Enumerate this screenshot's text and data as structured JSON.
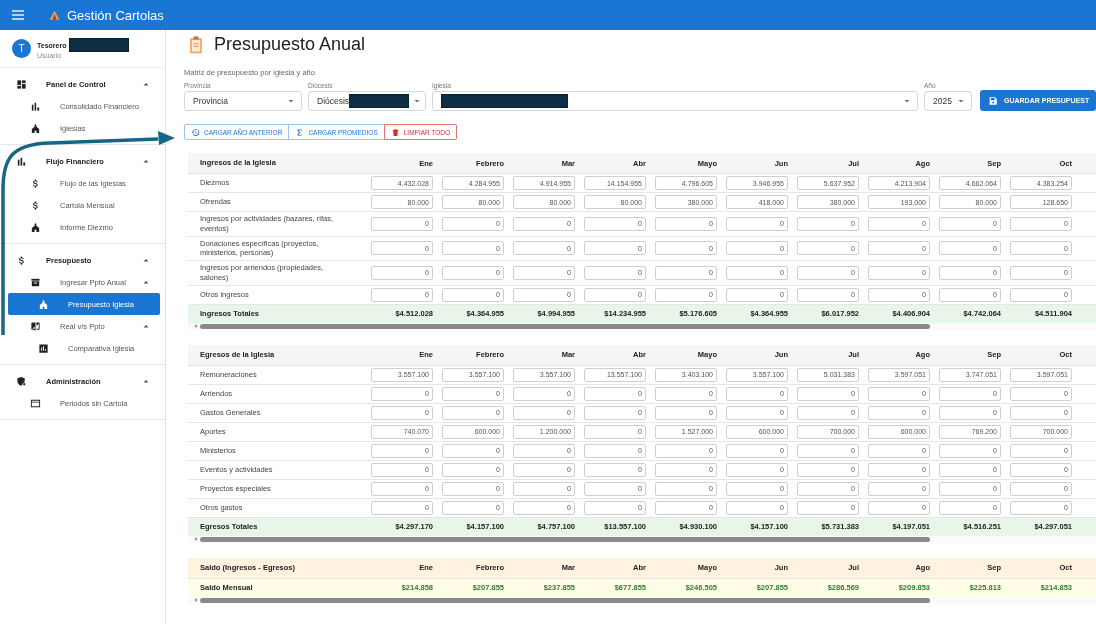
{
  "app_bar": {
    "title": "Gestión Cartolas"
  },
  "user": {
    "avatar": "T",
    "name": "Tesorero",
    "role": "Usuario",
    "redacted": true
  },
  "sidebar": {
    "sections": [
      {
        "label": "Panel de Control",
        "expanded": true,
        "items": [
          {
            "label": "Consolidado Financiero",
            "selected": false
          },
          {
            "label": "Iglesias",
            "selected": false
          }
        ]
      },
      {
        "label": "Flujo Financiero",
        "expanded": true,
        "items": [
          {
            "label": "Flujo de las Iglesias",
            "selected": false
          },
          {
            "label": "Cartola Mensual",
            "selected": false
          },
          {
            "label": "Informe Diezmo",
            "selected": false
          }
        ]
      },
      {
        "label": "Presupuesto",
        "expanded": true,
        "items": [
          {
            "label": "Ingresar Ppto Anual",
            "selected": false,
            "expanded": true,
            "children": [
              {
                "label": "Presupuesto Iglesia",
                "selected": true
              }
            ]
          },
          {
            "label": "Real v/s Ppto",
            "selected": false,
            "expanded": true,
            "children": [
              {
                "label": "Comparativa Iglesia",
                "selected": false
              }
            ]
          }
        ]
      },
      {
        "label": "Administración",
        "expanded": true,
        "items": [
          {
            "label": "Periodos sin Cartola",
            "selected": false
          }
        ]
      }
    ]
  },
  "page": {
    "title": "Presupuesto Anual",
    "subtitle": "Matriz de presupuesto por iglesia y año"
  },
  "filters": [
    {
      "label": "Provincia",
      "value": "Provincia"
    },
    {
      "label": "Diócesis",
      "value": "Diócesis",
      "redacted": true
    },
    {
      "label": "Iglesia",
      "redacted": true
    },
    {
      "label": "Año",
      "value": "2025"
    }
  ],
  "save_button": "GUARDAR PRESUPUEST",
  "actions": [
    {
      "label": "CARGAR AÑO ANTERIOR",
      "kind": "history"
    },
    {
      "label": "CARGAR PROMEDIOS",
      "kind": "sigma"
    },
    {
      "label": "LIMPIAR TODO",
      "kind": "danger"
    }
  ],
  "tables": [
    {
      "kind": "income",
      "title": "Ingresos de la Iglesia",
      "columns": [
        "Ene",
        "Febrero",
        "Mar",
        "Abr",
        "Mayo",
        "Jun",
        "Jul",
        "Ago",
        "Sep",
        "Oct"
      ],
      "rows": [
        {
          "label": "Diezmos",
          "values": [
            "4.432.028",
            "4.284.955",
            "4.914.955",
            "14.154.955",
            "4.796.605",
            "3.946.955",
            "5.637.952",
            "4.213.904",
            "4.662.064",
            "4.383.254"
          ]
        },
        {
          "label": "Ofrendas",
          "values": [
            "80.000",
            "80.000",
            "80.000",
            "80.000",
            "380.000",
            "418.000",
            "380.000",
            "193.000",
            "80.000",
            "128.650"
          ]
        },
        {
          "label": "Ingresos por actividades (bazares, rifas, eventos)",
          "values": [
            "0",
            "0",
            "0",
            "0",
            "0",
            "0",
            "0",
            "0",
            "0",
            "0"
          ]
        },
        {
          "label": "Donaciones específicas (proyectos, ministerios, personas)",
          "values": [
            "0",
            "0",
            "0",
            "0",
            "0",
            "0",
            "0",
            "0",
            "0",
            "0"
          ]
        },
        {
          "label": "Ingresos por arriendos (propiedades, salones)",
          "values": [
            "0",
            "0",
            "0",
            "0",
            "0",
            "0",
            "0",
            "0",
            "0",
            "0"
          ]
        },
        {
          "label": "Otros ingresos",
          "values": [
            "0",
            "0",
            "0",
            "0",
            "0",
            "0",
            "0",
            "0",
            "0",
            "0"
          ]
        }
      ],
      "total": {
        "label": "Ingresos Totales",
        "values": [
          "$4.512.028",
          "$4.364.955",
          "$4.994.955",
          "$14.234.955",
          "$5.176.605",
          "$4.364.955",
          "$6.017.952",
          "$4.406.904",
          "$4.742.064",
          "$4.511.904"
        ]
      }
    },
    {
      "kind": "expense",
      "title": "Egresos de la Iglesia",
      "columns": [
        "Ene",
        "Febrero",
        "Mar",
        "Abr",
        "Mayo",
        "Jun",
        "Jul",
        "Ago",
        "Sep",
        "Oct"
      ],
      "rows": [
        {
          "label": "Remuneraciones",
          "values": [
            "3.557.100",
            "3.557.100",
            "3.557.100",
            "13.557.100",
            "3.403.100",
            "3.557.100",
            "5.031.383",
            "3.597.051",
            "3.747.051",
            "3.597.051"
          ]
        },
        {
          "label": "Arriendos",
          "values": [
            "0",
            "0",
            "0",
            "0",
            "0",
            "0",
            "0",
            "0",
            "0",
            "0"
          ]
        },
        {
          "label": "Gastos Generales",
          "values": [
            "0",
            "0",
            "0",
            "0",
            "0",
            "0",
            "0",
            "0",
            "0",
            "0"
          ]
        },
        {
          "label": "Aportes",
          "values": [
            "740.070",
            "600.000",
            "1.200.000",
            "0",
            "1.527.000",
            "600.000",
            "700.000",
            "600.000",
            "769.200",
            "700.000"
          ]
        },
        {
          "label": "Ministerios",
          "values": [
            "0",
            "0",
            "0",
            "0",
            "0",
            "0",
            "0",
            "0",
            "0",
            "0"
          ]
        },
        {
          "label": "Eventos y actividades",
          "values": [
            "0",
            "0",
            "0",
            "0",
            "0",
            "0",
            "0",
            "0",
            "0",
            "0"
          ]
        },
        {
          "label": "Proyectos especiales",
          "values": [
            "0",
            "0",
            "0",
            "0",
            "0",
            "0",
            "0",
            "0",
            "0",
            "0"
          ]
        },
        {
          "label": "Otros gastos",
          "values": [
            "0",
            "0",
            "0",
            "0",
            "0",
            "0",
            "0",
            "0",
            "0",
            "0"
          ]
        }
      ],
      "total": {
        "label": "Egresos Totales",
        "values": [
          "$4.297.170",
          "$4.157.100",
          "$4.757.100",
          "$13.557.100",
          "$4.930.100",
          "$4.157.100",
          "$5.731.383",
          "$4.197.051",
          "$4.516.251",
          "$4.297.051"
        ]
      }
    },
    {
      "kind": "balance",
      "title": "Saldo (Ingresos - Egresos)",
      "columns": [
        "Ene",
        "Febrero",
        "Mar",
        "Abr",
        "Mayo",
        "Jun",
        "Jul",
        "Ago",
        "Sep",
        "Oct"
      ],
      "total": {
        "label": "Saldo Mensual",
        "values": [
          "$214.858",
          "$207.855",
          "$237.855",
          "$677.855",
          "$246.505",
          "$207.855",
          "$286.569",
          "$209.853",
          "$225.813",
          "$214.853"
        ]
      }
    }
  ]
}
